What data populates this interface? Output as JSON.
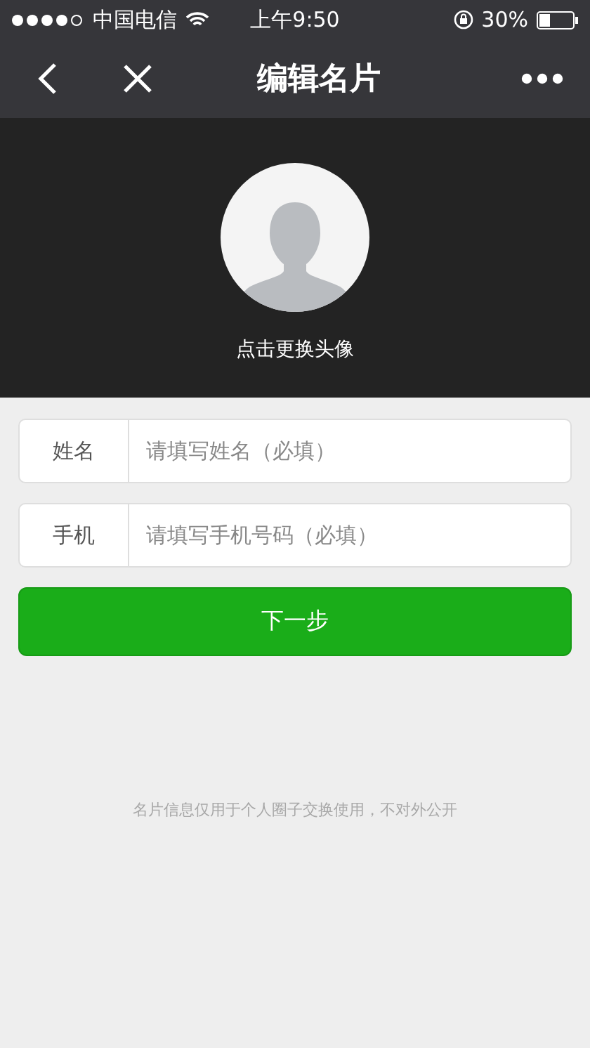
{
  "status_bar": {
    "carrier": "中国电信",
    "time": "上午9:50",
    "battery": "30%"
  },
  "nav": {
    "title": "编辑名片"
  },
  "avatar": {
    "caption": "点击更换头像"
  },
  "fields": [
    {
      "label": "姓名",
      "placeholder": "请填写姓名（必填）"
    },
    {
      "label": "手机",
      "placeholder": "请填写手机号码（必填）"
    }
  ],
  "next_button": "下一步",
  "footer_note": "名片信息仅用于个人圈子交换使用，不对外公开"
}
